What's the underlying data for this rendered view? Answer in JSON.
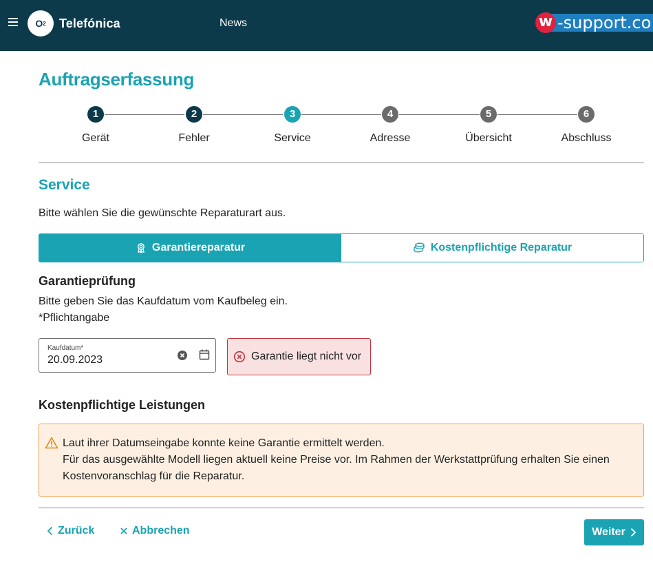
{
  "header": {
    "brand_logo_text": "O",
    "brand_logo_sub": "2",
    "brand_name": "Telefónica",
    "nav_news": "News",
    "support_badge_letter": "w",
    "support_badge_text": "-support.co"
  },
  "page": {
    "title": "Auftragserfassung"
  },
  "stepper": {
    "steps": [
      {
        "number": "1",
        "label": "Gerät",
        "state": "done"
      },
      {
        "number": "2",
        "label": "Fehler",
        "state": "done"
      },
      {
        "number": "3",
        "label": "Service",
        "state": "active"
      },
      {
        "number": "4",
        "label": "Adresse",
        "state": "todo"
      },
      {
        "number": "5",
        "label": "Übersicht",
        "state": "todo"
      },
      {
        "number": "6",
        "label": "Abschluss",
        "state": "todo"
      }
    ]
  },
  "service": {
    "title": "Service",
    "intro": "Bitte wählen Sie die gewünschte Reparaturart aus.",
    "options": {
      "warranty": "Garantiereparatur",
      "paid": "Kostenpflichtige Reparatur"
    },
    "selected": "warranty"
  },
  "warranty_check": {
    "heading": "Garantieprüfung",
    "instruction": "Bitte geben Sie das Kaufdatum vom Kaufbeleg ein.",
    "required_note": "*Pflichtangabe",
    "date_label": "Kaufdatum*",
    "date_value": "20.09.2023",
    "result": "Garantie liegt nicht vor"
  },
  "paid_services": {
    "heading": "Kostenpflichtige Leistungen",
    "notice_line1": "Laut ihrer Datumseingabe konnte keine Garantie ermittelt werden.",
    "notice_line2": "Für das ausgewählte Modell liegen aktuell keine Preise vor. Im Rahmen der Werkstattprüfung erhalten Sie einen Kostenvoranschlag für die Reparatur."
  },
  "footer": {
    "back": "Zurück",
    "cancel": "Abbrechen",
    "next": "Weiter"
  },
  "colors": {
    "accent": "#1aa3b3",
    "header_bg": "#0c3a4a",
    "error_bg": "#f9e1e1",
    "error_border": "#c0323f",
    "warning_bg": "#fdf0e3",
    "warning_border": "#f0a04b"
  }
}
